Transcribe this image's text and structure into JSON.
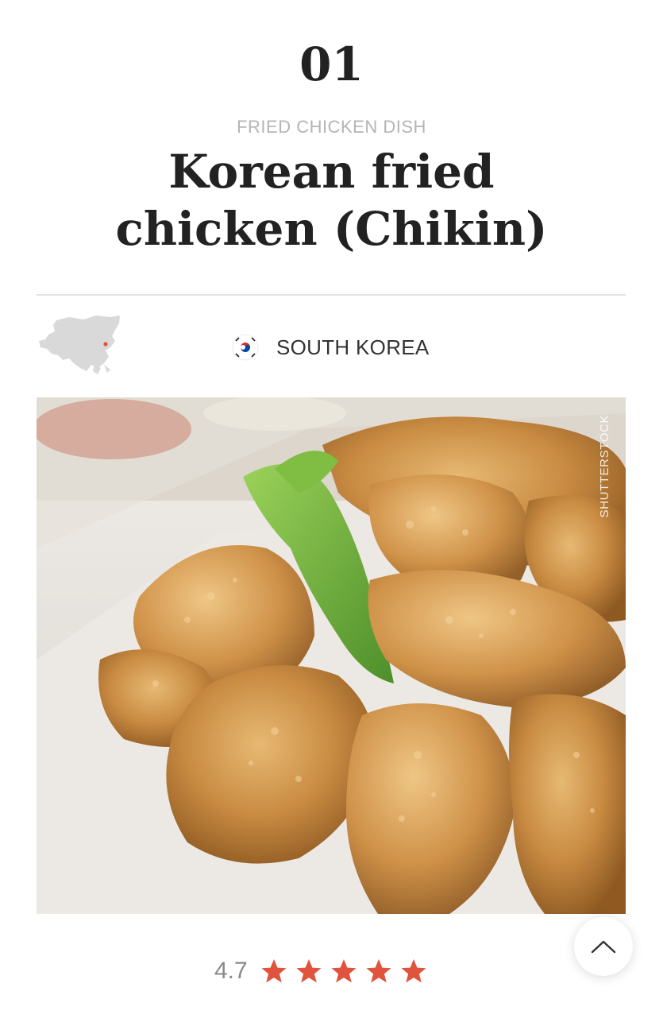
{
  "dish": {
    "rank": "01",
    "category": "FRIED CHICKEN DISH",
    "name": "Korean fried chicken (Chikin)",
    "name_line1": "Korean fried",
    "name_line2": "chicken (Chikin)"
  },
  "origin": {
    "country": "SOUTH KOREA",
    "flag_icon": "south-korea-flag-icon",
    "map_icon": "asia-map-icon"
  },
  "photo": {
    "credit": "SHUTTERSTOCK"
  },
  "rating": {
    "value": "4.7",
    "stars": 5,
    "star_color": "#e0533d"
  },
  "controls": {
    "scroll_top_icon": "chevron-up-icon"
  },
  "colors": {
    "accent": "#e0533d",
    "title": "#222222",
    "muted": "#b5b5b5"
  }
}
